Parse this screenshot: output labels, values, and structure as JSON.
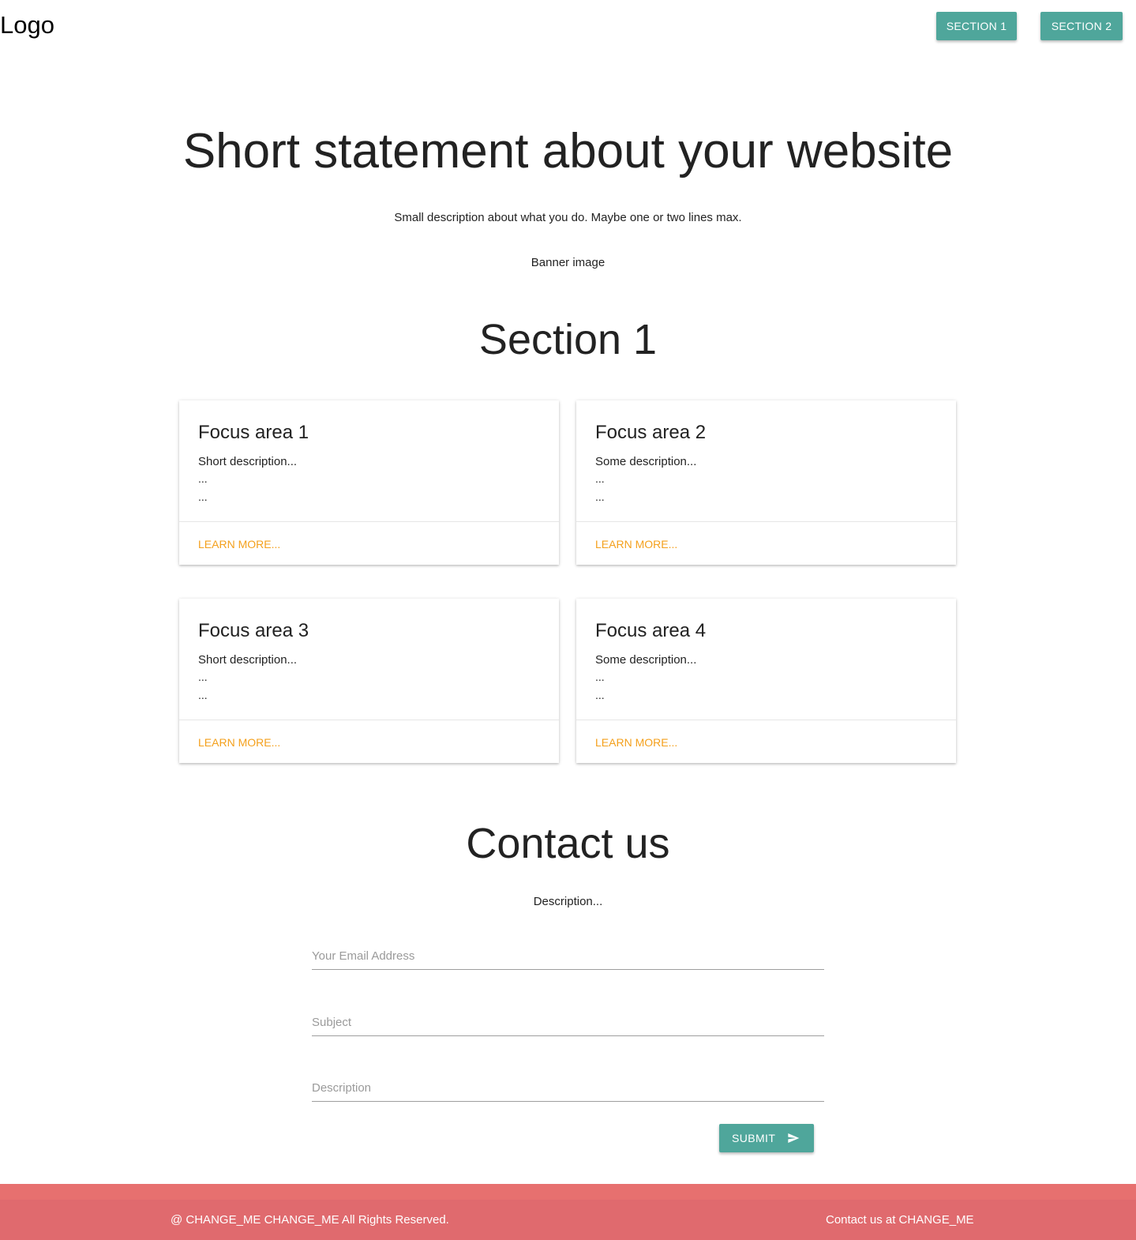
{
  "header": {
    "logo": "Logo",
    "nav": [
      {
        "label": "SECTION 1"
      },
      {
        "label": "SECTION 2"
      }
    ]
  },
  "hero": {
    "title": "Short statement about your website",
    "description": "Small description about what you do. Maybe one or two lines max.",
    "banner": "Banner image"
  },
  "section1": {
    "title": "Section 1",
    "cards": [
      {
        "title": "Focus area 1",
        "description": "Short description...",
        "line2": "...",
        "line3": "...",
        "action": "LEARN MORE..."
      },
      {
        "title": "Focus area 2",
        "description": "Some description...",
        "line2": "...",
        "line3": "...",
        "action": "LEARN MORE..."
      },
      {
        "title": "Focus area 3",
        "description": "Short description...",
        "line2": "...",
        "line3": "...",
        "action": "LEARN MORE..."
      },
      {
        "title": "Focus area 4",
        "description": "Some description...",
        "line2": "...",
        "line3": "...",
        "action": "LEARN MORE..."
      }
    ]
  },
  "contact": {
    "title": "Contact us",
    "description": "Description...",
    "email_placeholder": "Your Email Address",
    "subject_placeholder": "Subject",
    "description_placeholder": "Description",
    "submit_label": "SUBMIT",
    "submit_icon": "send-icon"
  },
  "footer": {
    "copyright": "@ CHANGE_ME CHANGE_ME All Rights Reserved.",
    "contact": "Contact us at CHANGE_ME"
  },
  "colors": {
    "primary": "#4fa69b",
    "accent": "#f4a01c",
    "footer": "#e06a6e"
  }
}
